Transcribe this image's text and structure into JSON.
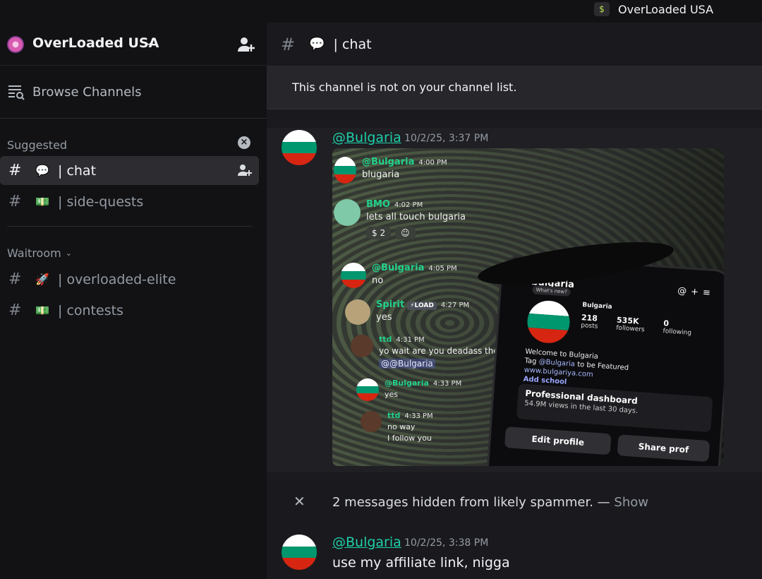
{
  "titlebar": {
    "server_name": "OverLoaded USA",
    "server_icon": "money-bag-icon"
  },
  "sidebar": {
    "server_name": "OverLoaded USA",
    "browse_label": "Browse Channels",
    "sections": {
      "suggested": "Suggested",
      "waitroom": "Waitroom"
    },
    "channels": [
      {
        "hash": "#",
        "emoji": "💬",
        "name": "| chat",
        "active": true
      },
      {
        "hash": "#",
        "emoji": "💵",
        "name": "| side-quests",
        "active": false
      },
      {
        "hash": "#",
        "emoji": "🚀",
        "name": "| overloaded-elite",
        "active": false
      },
      {
        "hash": "#",
        "emoji": "💵",
        "name": "| contests",
        "active": false
      }
    ]
  },
  "header": {
    "hash": "#",
    "emoji": "💬",
    "title": "| chat"
  },
  "notice": "This channel is not on your channel list.",
  "messages": [
    {
      "author": "@Bulgaria",
      "time": "10/2/25, 3:37 PM"
    },
    {
      "author": "@Bulgaria",
      "time": "10/2/25, 3:38 PM",
      "text": "use my affiliate link, nigga"
    }
  ],
  "attachment": {
    "chat": [
      {
        "name": "@Bulgaria",
        "time": "4:00 PM",
        "text": "blugaria"
      },
      {
        "name": "BMO",
        "time": "4:02 PM",
        "text": "lets all touch bulgaria",
        "reaction_count": "2"
      },
      {
        "name": "@Bulgaria",
        "time": "4:05 PM",
        "text": "no"
      },
      {
        "name": "Spirit",
        "badge": "⚡LOAD",
        "time": "4:27 PM",
        "text": "yes"
      },
      {
        "name": "ttd",
        "time": "4:31 PM",
        "text": "yo wait are you deadass the real @",
        "mention": "@@Bulgaria"
      },
      {
        "name": "@Bulgaria",
        "time": "4:33 PM",
        "text": "yes"
      },
      {
        "name": "ttd",
        "time": "4:33 PM",
        "text": "no way",
        "text2": "I follow you"
      }
    ],
    "phone": {
      "handle": "bulgaria",
      "bubble": "What's new?",
      "display_name": "Bulgaria",
      "posts_n": "218",
      "posts_l": "posts",
      "followers_n": "535K",
      "followers_l": "followers",
      "following_n": "0",
      "following_l": "following",
      "bio1": "Welcome to Bulgaria",
      "bio2_pre": "Tag",
      "bio2_tag": "@Bulgaria",
      "bio2_post": "to be Featured",
      "link": "www.bulgariya.com",
      "add_school": "Add school",
      "dash_title": "Professional dashboard",
      "dash_sub": "54.9M views in the last 30 days.",
      "edit": "Edit profile",
      "share": "Share prof"
    }
  },
  "hidden_note": {
    "text": "2 messages hidden from likely spammer. —",
    "show": "Show"
  },
  "colors": {
    "accent": "#1ecfa8",
    "sidebar_bg": "#121214",
    "main_bg": "#1a1a1e"
  }
}
